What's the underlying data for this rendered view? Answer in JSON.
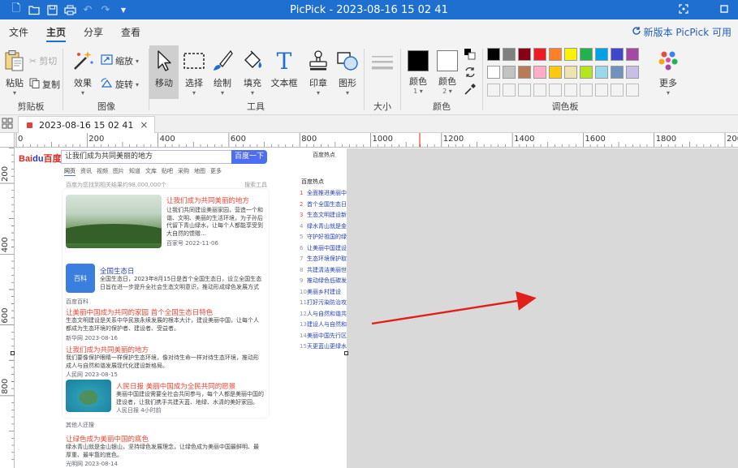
{
  "window": {
    "title": "PicPick - 2023-08-16 15 02 41",
    "quick_access": [
      "new-file-icon",
      "open-folder-icon",
      "save-icon",
      "print-icon",
      "undo-icon",
      "redo-icon",
      "customize-icon"
    ]
  },
  "menu": {
    "tabs": [
      {
        "label": "文件",
        "active": false
      },
      {
        "label": "主页",
        "active": true
      },
      {
        "label": "分享",
        "active": false
      },
      {
        "label": "查看",
        "active": false
      }
    ],
    "update_notice": "新版本 PicPick 可用"
  },
  "ribbon": {
    "clipboard": {
      "label": "剪贴板",
      "paste": "粘贴",
      "cut": "剪切",
      "copy": "复制"
    },
    "image": {
      "label": "图像",
      "effects": "效果",
      "resize": "缩放",
      "rotate": "旋转"
    },
    "tools": {
      "label": "工具",
      "move": "移动",
      "select": "选择",
      "draw": "绘制",
      "fill": "填充",
      "textbox": "文本框",
      "stamp": "印章",
      "shape": "图形"
    },
    "size": {
      "label": "大小"
    },
    "colors": {
      "label": "颜色",
      "color1": "颜色",
      "color1_index": "1",
      "color2": "颜色",
      "color2_index": "2",
      "primary": "#000000",
      "secondary": "#ffffff"
    },
    "palette": {
      "label": "调色板",
      "more": "更多",
      "row1": [
        "#000000",
        "#7f7f7f",
        "#880015",
        "#ed1c24",
        "#ff7f27",
        "#fff200",
        "#22b14c",
        "#00a2e8",
        "#3f48cc",
        "#a349a4"
      ],
      "row2": [
        "#ffffff",
        "#c3c3c3",
        "#b97a57",
        "#ffaec9",
        "#ffc90e",
        "#efe4b0",
        "#b5e61d",
        "#99d9ea",
        "#7092be",
        "#c8bfe7"
      ],
      "row3": [
        "#f3f3f3",
        "#f3f3f3",
        "#f3f3f3",
        "#f3f3f3",
        "#f3f3f3",
        "#f3f3f3",
        "#f3f3f3",
        "#f3f3f3",
        "#f3f3f3",
        "#f3f3f3"
      ]
    }
  },
  "document_tab": {
    "label": "2023-08-16 15 02 41"
  },
  "rulers": {
    "horizontal_labels": [
      "0",
      "200",
      "400",
      "600",
      "800",
      "1000",
      "1200",
      "1400",
      "1600",
      "1800",
      "2000"
    ],
    "vertical_labels": [
      "200",
      "400",
      "600",
      "800"
    ]
  },
  "screenshot": {
    "logo": "Bai",
    "logo_paw": "du",
    "logo_cn": "百度",
    "search_query": "让我们成为共同美丽的地方",
    "search_button": "百度一下",
    "nav": [
      "网页",
      "资讯",
      "视频",
      "图片",
      "知道",
      "文库",
      "贴吧",
      "采购",
      "地图",
      "更多"
    ],
    "result_count": "百度为您找到相关结果约98,000,000个",
    "filter": "搜索工具",
    "right_header": "百度热点",
    "results": [
      {
        "title": "让我们成为共同美丽的地方",
        "text": "让我们共同建设美丽家园，营造一个和谐、文明、美丽的生活环境，为子孙后代留下青山绿水，让每个人都能享受到大自然的馈赠...",
        "meta": "百家号 2022-11-06"
      },
      {
        "title": "全国生态日",
        "text": "全国生态日，2023年8月15日是首个全国生态日，设立全国生态日旨在进一步提升全社会生态文明意识，推动形成绿色发展方式和生活方式。",
        "meta": "百度百科"
      },
      {
        "title": "让美丽中国成为共同的家园 首个全国生态日特色",
        "text": "生态文明建设是关系中华民族永续发展的根本大计，建设美丽中国，让每个人都成为生态环境的保护者、建设者、受益者。",
        "meta": "新华网 2023-08-16"
      },
      {
        "title": "让我们成为共同美丽的地方",
        "text": "我们要像保护眼睛一样保护生态环境，像对待生命一样对待生态环境，推动形成人与自然和谐发展现代化建设新格局。",
        "meta": "人民网 2023-08-15"
      },
      {
        "title": "人民日报 美丽中国成为全民共同的愿景",
        "text": "美丽中国建设需要全社会共同参与，每个人都是美丽中国的建设者，让我们携手共建天蓝、地绿、水清的美好家园。",
        "meta": "人民日报 4小时前"
      },
      {
        "title": "让绿色成为美丽中国的底色",
        "text": "绿水青山就是金山银山，坚持绿色发展理念，让绿色成为美丽中国最鲜明、最厚重、最牢靠的底色。",
        "meta": "光明网 2023-08-14"
      }
    ],
    "hot_list": [
      "全面推进美丽中国建设",
      "首个全国生态日",
      "生态文明建设新成就",
      "绿水青山就是金山银山",
      "守护好祖国的绿水青山",
      "让美丽中国建设成果惠及人民",
      "生态环境保护取得新进展",
      "共建清洁美丽世界",
      "推动绿色低碳发展",
      "美丽乡村建设",
      "打好污染防治攻坚战",
      "人与自然和谐共生",
      "建设人与自然和谐共生的现代化",
      "美丽中国先行区建设",
      "天更蓝山更绿水更清"
    ],
    "related_label": "其他人还搜"
  },
  "annotation": {
    "arrow_color": "#e0201b"
  }
}
